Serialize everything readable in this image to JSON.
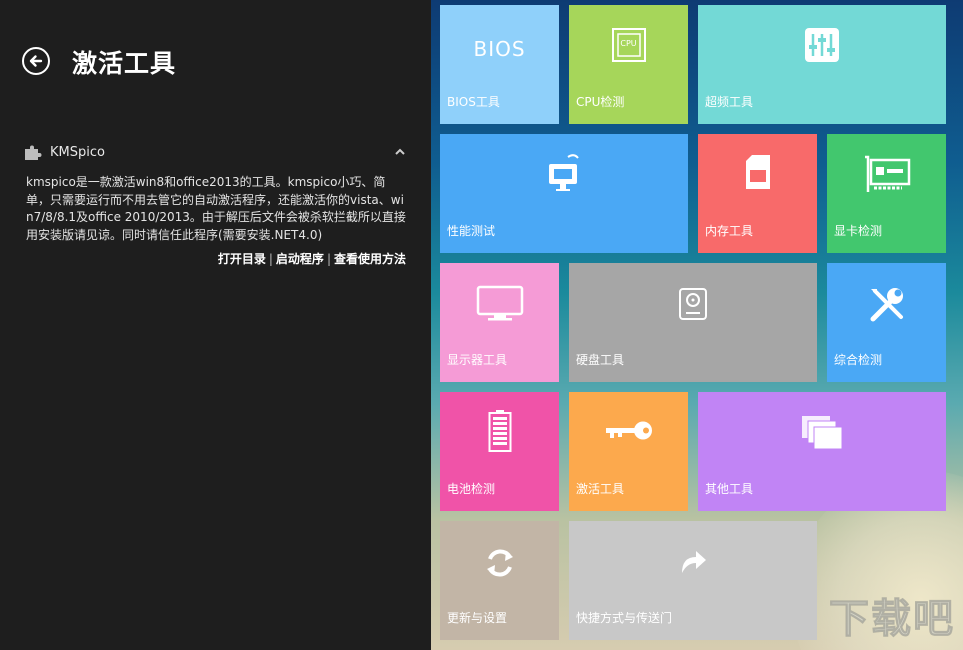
{
  "header": {
    "title": "激活工具"
  },
  "item": {
    "name": "KMSpico",
    "description": "kmspico是一款激活win8和office2013的工具。kmspico小巧、简单，只需要运行而不用去管它的自动激活程序，还能激活你的vista、win7/8/8.1及office 2010/2013。由于解压后文件会被杀软拦截所以直接用安装版请见谅。同时请信任此程序(需要安装.NET4.0)",
    "links": [
      "打开目录",
      "启动程序",
      "查看使用方法"
    ]
  },
  "tiles": [
    {
      "label": "BIOS工具",
      "icon_text": "BIOS",
      "color": "#8fd0fa",
      "icon": "bios-text-icon"
    },
    {
      "label": "CPU检测",
      "icon_text": "CPU",
      "color": "#a6d65a",
      "icon": "cpu-icon"
    },
    {
      "label": "超频工具",
      "color": "#73d9d6",
      "icon": "equalizer-icon"
    },
    {
      "label": "性能测试",
      "color": "#4aa8f5",
      "icon": "monitor-chart-icon"
    },
    {
      "label": "内存工具",
      "color": "#f86a6a",
      "icon": "sd-card-icon"
    },
    {
      "label": "显卡检测",
      "color": "#42c76e",
      "icon": "graphics-card-icon"
    },
    {
      "label": "显示器工具",
      "color": "#f59bd6",
      "icon": "display-icon"
    },
    {
      "label": "硬盘工具",
      "color": "#a6a6a6",
      "icon": "hard-disk-icon"
    },
    {
      "label": "综合检测",
      "color": "#4aa8f5",
      "icon": "tools-icon"
    },
    {
      "label": "电池检测",
      "color": "#f053a8",
      "icon": "battery-icon"
    },
    {
      "label": "激活工具",
      "color": "#fca94d",
      "icon": "key-icon"
    },
    {
      "label": "其他工具",
      "color": "#c184f5",
      "icon": "windows-stack-icon"
    },
    {
      "label": "更新与设置",
      "color": "#c2b5a6",
      "icon": "refresh-icon"
    },
    {
      "label": "快捷方式与传送门",
      "color": "#c8c8c8",
      "icon": "share-arrow-icon"
    }
  ],
  "watermark": "下载吧"
}
